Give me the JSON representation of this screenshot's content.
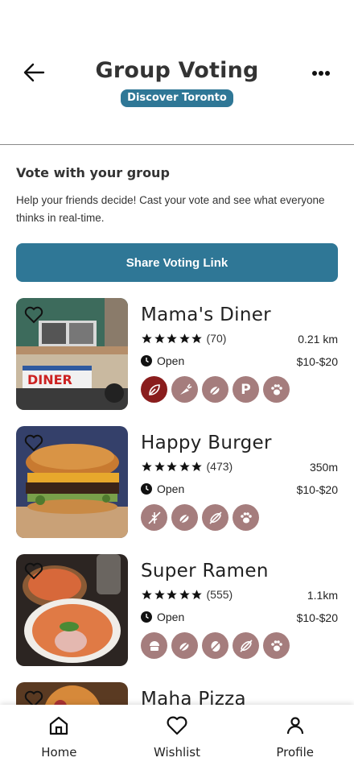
{
  "header": {
    "title": "Group Voting",
    "city_pill": "Discover Toronto",
    "back_icon": "arrow-left-icon",
    "more_icon": "more-horizontal-icon"
  },
  "intro": {
    "title": "Vote with your group",
    "description": "Help your friends decide! Cast your vote and see what everyone thinks in real-time.",
    "share_label": "Share Voting Link"
  },
  "restaurants": [
    {
      "name": "Mama's Diner",
      "rating": 5,
      "reviews": "(70)",
      "distance": "0.21 km",
      "status": "Open",
      "price": "$10-$20",
      "tags": [
        "vegan-leaf-icon",
        "carrot-icon",
        "gluten-free-icon",
        "parking-icon",
        "pet-friendly-icon"
      ],
      "tag_text": [
        "",
        "",
        "",
        "P",
        ""
      ]
    },
    {
      "name": "Happy Burger",
      "rating": 5,
      "reviews": "(473)",
      "distance": "350m",
      "status": "Open",
      "price": "$10-$20",
      "tags": [
        "no-wheat-icon",
        "gluten-free-icon",
        "no-nuts-icon",
        "pet-friendly-icon"
      ]
    },
    {
      "name": "Super Ramen",
      "rating": 5,
      "reviews": "(555)",
      "distance": "1.1km",
      "status": "Open",
      "price": "$10-$20",
      "tags": [
        "dessert-icon",
        "gluten-free-icon",
        "no-egg-icon",
        "no-nuts-icon",
        "pet-friendly-icon"
      ]
    },
    {
      "name": "Maha Pizza"
    }
  ],
  "nav": {
    "items": [
      {
        "label": "Home",
        "icon": "home-icon"
      },
      {
        "label": "Wishlist",
        "icon": "heart-icon"
      },
      {
        "label": "Profile",
        "icon": "user-icon"
      }
    ]
  },
  "colors": {
    "primary": "#2f7796",
    "tag_bg": "#a57d7d",
    "tag_active": "#8a1d1d"
  }
}
